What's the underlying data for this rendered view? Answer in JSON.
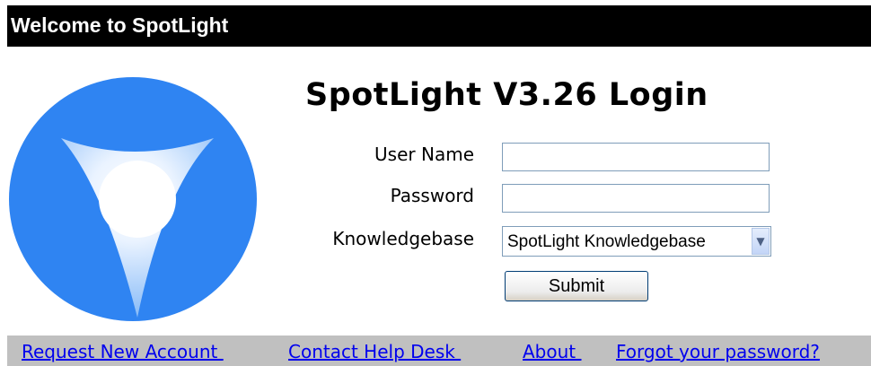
{
  "header": {
    "title": "Welcome to SpotLight"
  },
  "login": {
    "title": "SpotLight V3.26 Login",
    "username_label": "User Name",
    "username_value": "",
    "password_label": "Password",
    "password_value": "",
    "knowledgebase_label": "Knowledgebase",
    "knowledgebase_selected": "SpotLight Knowledgebase",
    "submit_label": "Submit"
  },
  "footer": {
    "links": [
      {
        "label": "Request New Account "
      },
      {
        "label": "Contact Help Desk "
      },
      {
        "label": "About "
      },
      {
        "label": "Forgot your password?"
      }
    ]
  },
  "colors": {
    "header_bg": "#000000",
    "logo_blue": "#2f84f2",
    "footer_bg": "#c0c0c0",
    "link": "#0000ee"
  },
  "icons": {
    "logo": "spotlight-logo-icon",
    "select_arrow": "chevron-down-icon"
  }
}
